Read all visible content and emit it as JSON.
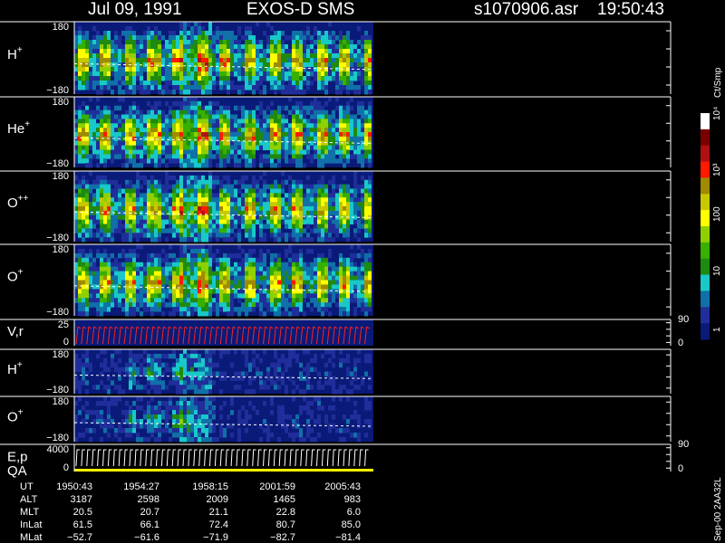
{
  "title": {
    "date": "Jul 09, 1991",
    "instrument": "EXOS-D SMS",
    "file": "s1070906.asr",
    "time": "19:50:43"
  },
  "chart_data": {
    "type": "heatmap",
    "panels": [
      {
        "id": "h-plus",
        "label": "H",
        "sup": "+",
        "ytick_top": "180",
        "ytick_bottom": "−180",
        "ylim": [
          -180,
          180
        ]
      },
      {
        "id": "he-plus",
        "label": "He",
        "sup": "+",
        "ytick_top": "180",
        "ytick_bottom": "−180",
        "ylim": [
          -180,
          180
        ]
      },
      {
        "id": "o-plusplus",
        "label": "O",
        "sup": "++",
        "ytick_top": "180",
        "ytick_bottom": "−180",
        "ylim": [
          -180,
          180
        ]
      },
      {
        "id": "o-plus",
        "label": "O",
        "sup": "+",
        "ytick_top": "180",
        "ytick_bottom": "−180",
        "ylim": [
          -180,
          180
        ]
      },
      {
        "id": "vr",
        "label": "V,r",
        "ytick_top": "25",
        "ytick_bottom": "0",
        "ylim": [
          0,
          25
        ],
        "right_ticks": [
          "90",
          "0"
        ]
      },
      {
        "id": "h-plus-2",
        "label": "H",
        "sup": "+",
        "ytick_top": "180",
        "ytick_bottom": "−180",
        "ylim": [
          -180,
          180
        ]
      },
      {
        "id": "o-plus-2",
        "label": "O",
        "sup": "+",
        "ytick_top": "180",
        "ytick_bottom": "−180",
        "ylim": [
          -180,
          180
        ]
      },
      {
        "id": "ep-qa",
        "label": "E,p",
        "label2": "QA",
        "ytick_top": "4000",
        "ytick_bottom": "0",
        "right_ticks": [
          "90",
          "0"
        ]
      }
    ],
    "colorbar": {
      "unit": "Ct/Smp",
      "ticks": [
        "10⁴",
        "10³",
        "100",
        "10",
        "1"
      ],
      "colors": [
        "#ffffff",
        "#7a0000",
        "#b01010",
        "#ff1a00",
        "#a08a00",
        "#c8c800",
        "#ffff00",
        "#8ed000",
        "#38b000",
        "#1f8a10",
        "#19c8c8",
        "#1070a8",
        "#1f2e9a",
        "#0a1a78"
      ]
    },
    "ephemeris": {
      "rows": [
        {
          "name": "UT",
          "values": [
            "1950:43",
            "1954:27",
            "1958:15",
            "2001:59",
            "2005:43"
          ]
        },
        {
          "name": "ALT",
          "values": [
            "3187",
            "2598",
            "2009",
            "1465",
            "983"
          ]
        },
        {
          "name": "MLT",
          "values": [
            "20.5",
            "20.7",
            "21.1",
            "22.8",
            "6.0"
          ]
        },
        {
          "name": "InLat",
          "values": [
            "61.5",
            "66.1",
            "72.4",
            "80.7",
            "85.0"
          ]
        },
        {
          "name": "MLat",
          "values": [
            "−52.7",
            "−61.6",
            "−71.9",
            "−82.7",
            "−81.4"
          ]
        }
      ]
    }
  },
  "footer": {
    "stamp": "Sep-00 2AA32L"
  }
}
